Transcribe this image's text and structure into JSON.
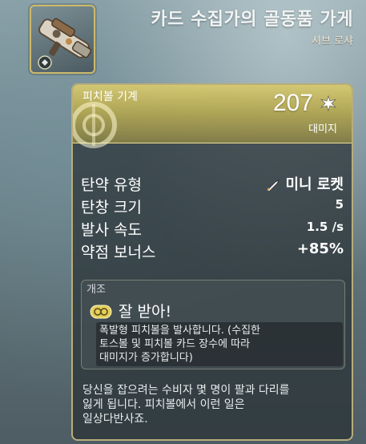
{
  "header": {
    "title": "카드 수집가의 골동품 가게",
    "subtitle": "셔브 로샤",
    "thumbnail_icon": "weapon-gun-icon"
  },
  "weapon": {
    "type_label": "피치볼 기계",
    "damage_value": "207",
    "damage_caption": "대미지",
    "damage_icon": "blast-icon",
    "emblem_icon": "trigger-emblem-icon"
  },
  "stats": [
    {
      "label": "탄약 유형",
      "value": "미니 로켓",
      "icon": "rocket-icon"
    },
    {
      "label": "탄창 크기",
      "value": "5"
    },
    {
      "label": "발사 속도",
      "value": "1.5 /s"
    },
    {
      "label": "약점 보너스",
      "value": "+85%"
    }
  ],
  "mod": {
    "header": "개조",
    "name": "잘 받아!",
    "icon": "mod-badge-icon",
    "description_lines": [
      "폭발형 피치볼을 발사합니다. (수집한",
      "토스볼 및 피치볼 카드 장수에 따라",
      "대미지가 증가합니다)"
    ]
  },
  "flavor_lines": [
    "당신을 잡으려는 수비자 몇 명이 팔과 다리를",
    "잃게 됩니다. 피치볼에서 이런 일은",
    "일상다반사죠."
  ],
  "colors": {
    "panel_border": "#b8ae7a",
    "header_gold": "#e2d476",
    "thumb_border": "#cdb96a"
  }
}
